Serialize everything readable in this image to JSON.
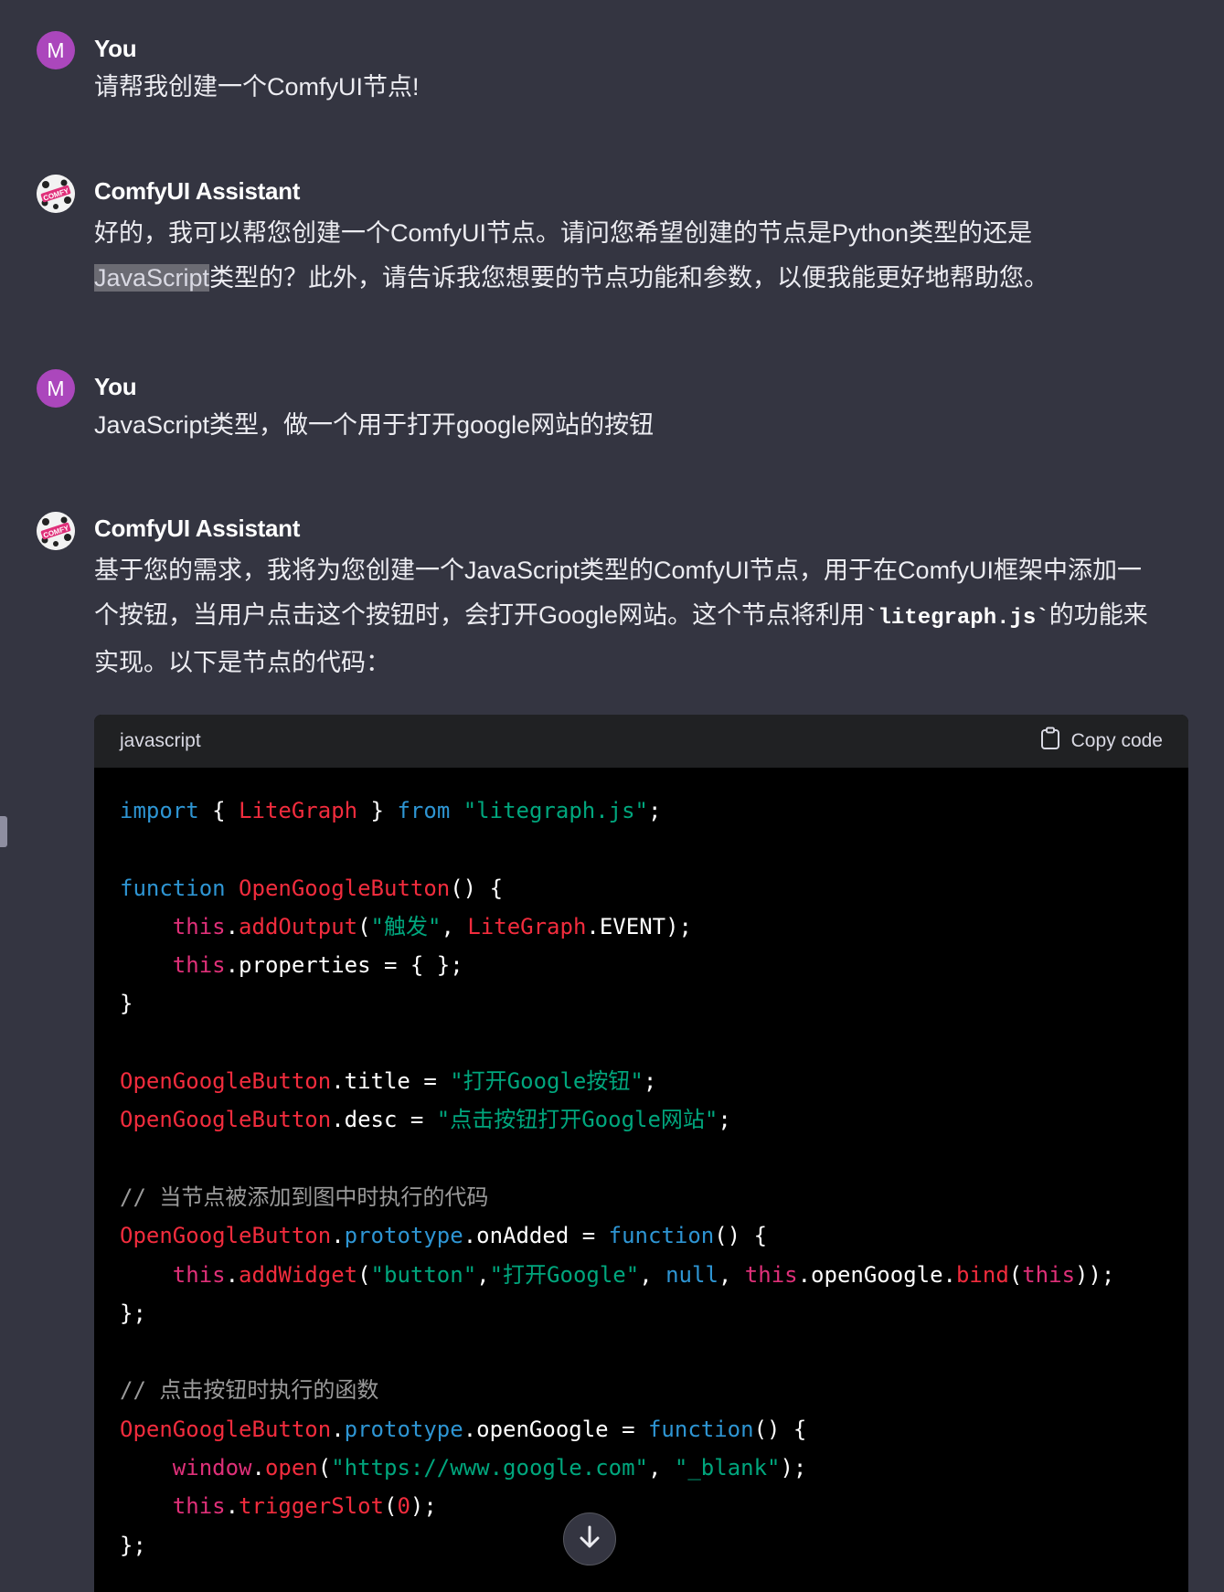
{
  "messages": [
    {
      "author": "You",
      "avatar_letter": "M",
      "text": "请帮我创建一个ComfyUI节点!"
    },
    {
      "author": "ComfyUI Assistant",
      "avatar_icon": "comfy-logo-icon",
      "text_line1": "好的，我可以帮您创建一个ComfyUI节点。请问您希望创建的节点是Python类型的还是",
      "highlight": "JavaScript",
      "text_line2_rest": "类型的？此外，请告诉我您想要的节点功能和参数，以便我能更好地帮助您。"
    },
    {
      "author": "You",
      "avatar_letter": "M",
      "text": "JavaScript类型，做一个用于打开google网站的按钮"
    },
    {
      "author": "ComfyUI Assistant",
      "avatar_icon": "comfy-logo-icon",
      "text_line1": "基于您的需求，我将为您创建一个JavaScript类型的ComfyUI节点，用于在ComfyUI框架中添加一",
      "text_line2_pre": "个按钮，当用户点击这个按钮时，会打开Google网站。这个节点将利用",
      "inline_code": "`litegraph.js`",
      "text_line2_post": "的功能来",
      "text_line3": "实现。以下是节点的代码："
    }
  ],
  "code_block": {
    "language": "javascript",
    "copy_label": "Copy code"
  },
  "colors": {
    "background": "#343541",
    "code_bg": "#000000",
    "keyword": "#2e95d3",
    "function": "#f22c3d",
    "string": "#00a67d",
    "this": "#df3079"
  },
  "scroll_icon": "arrow-down-icon"
}
